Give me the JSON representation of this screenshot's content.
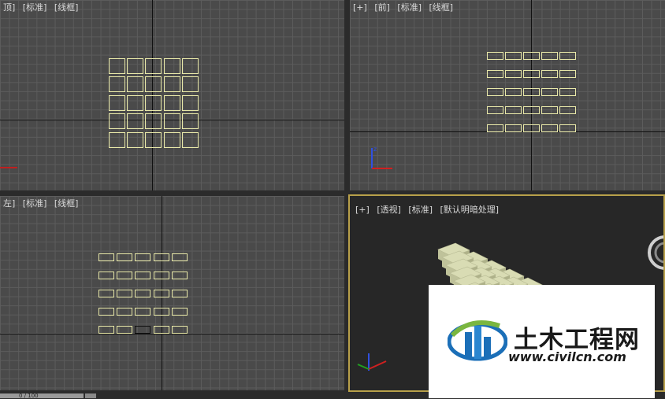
{
  "viewports": {
    "top": {
      "label_parts": [
        "顶]",
        "[标准]",
        "[线框]"
      ]
    },
    "front": {
      "label_parts": [
        "[+]",
        "[前]",
        "[标准]",
        "[线框]"
      ]
    },
    "left": {
      "label_parts": [
        "左]",
        "[标准]",
        "[线框]"
      ]
    },
    "perspective": {
      "label_parts": [
        "[+]",
        "[透视]",
        "[标准]",
        "[默认明暗处理]"
      ]
    }
  },
  "colors": {
    "wire": "#e8e8a8",
    "viewport_bg": "#4a4a4a",
    "active_border": "#b8a04a",
    "shaded_box": "#d9dcb4"
  },
  "watermark": {
    "title": "土木工程网",
    "url": "www.civilcn.com"
  },
  "timeline": {
    "frame_text": "0 / 100"
  },
  "icons": [
    "axis-gizmo-icon",
    "viewcube-icon",
    "civilcn-logo-icon"
  ]
}
